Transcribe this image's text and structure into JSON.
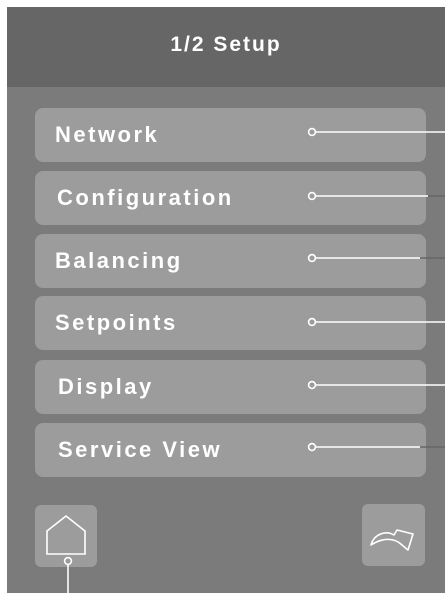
{
  "header": {
    "title": "1/2 Setup"
  },
  "menu": {
    "items": [
      {
        "label": "Network"
      },
      {
        "label": "Configuration"
      },
      {
        "label": "Balancing"
      },
      {
        "label": "Setpoints"
      },
      {
        "label": "Display"
      },
      {
        "label": "Service View"
      }
    ]
  },
  "footer": {
    "home_icon": "home-icon",
    "next_icon": "curved-arrow-icon"
  },
  "colors": {
    "screen_background": "#7b7b7b",
    "header_background": "#666666",
    "button_background": "#9c9c9c",
    "text": "#ffffff"
  }
}
